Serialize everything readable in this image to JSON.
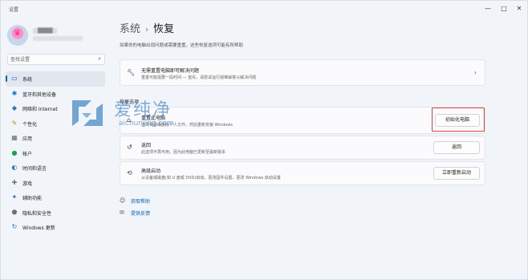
{
  "window": {
    "app_title": "设置",
    "min_glyph": "—",
    "max_glyph": "□",
    "close_glyph": "✕"
  },
  "profile": {
    "avatar_glyph": "♛",
    "username": "████",
    "email": ""
  },
  "search": {
    "placeholder": "查找设置",
    "value": ""
  },
  "sidebar": {
    "items": [
      {
        "label": "系统",
        "icon": "monitor-icon",
        "glyph": "▭",
        "color": "#0067c0",
        "active": true
      },
      {
        "label": "蓝牙和其他设备",
        "icon": "bluetooth-icon",
        "glyph": "✱",
        "color": "#0a78d4",
        "active": false
      },
      {
        "label": "网络和 Internet",
        "icon": "wifi-icon",
        "glyph": "◆",
        "color": "#2b6fc9",
        "active": false
      },
      {
        "label": "个性化",
        "icon": "brush-icon",
        "glyph": "✎",
        "color": "#d9761b",
        "active": false
      },
      {
        "label": "应用",
        "icon": "apps-icon",
        "glyph": "▦",
        "color": "#5a6b7f",
        "active": false
      },
      {
        "label": "帐户",
        "icon": "person-icon",
        "glyph": "●",
        "color": "#1f9d55",
        "active": false
      },
      {
        "label": "时间和语言",
        "icon": "globe-clock-icon",
        "glyph": "◐",
        "color": "#1a79c4",
        "active": false
      },
      {
        "label": "游戏",
        "icon": "gamepad-icon",
        "glyph": "✚",
        "color": "#6b7684",
        "active": false
      },
      {
        "label": "辅助功能",
        "icon": "accessibility-icon",
        "glyph": "✦",
        "color": "#1d6fbf",
        "active": false
      },
      {
        "label": "隐私和安全性",
        "icon": "shield-icon",
        "glyph": "⬟",
        "color": "#66707c",
        "active": false
      },
      {
        "label": "Windows 更新",
        "icon": "update-icon",
        "glyph": "↻",
        "color": "#1a79c4",
        "active": false
      }
    ]
  },
  "header": {
    "crumb_parent": "系统",
    "separator": "›",
    "crumb_current": "恢复",
    "description": "如果你的电脑出现问题或需要重置，这些恢复选项可能有所帮助"
  },
  "fix_card": {
    "title": "无需重置电脑即可解决问题",
    "subtitle": "重置可能需要一段时间 — 首先，请尝试运行疑难解答以解决问题",
    "icon": "wrench-icon",
    "chevron": "›"
  },
  "recovery_options": {
    "section_label": "恢复选项",
    "items": [
      {
        "title": "重置此电脑",
        "subtitle": "选择保留或删除个人文件，然后重新安装 Windows",
        "icon": "reset-pc-icon",
        "glyph": "⌂",
        "button": "初始化电脑"
      },
      {
        "title": "返回",
        "subtitle": "此选项不再可用，因为此电脑已更新至最新版本",
        "icon": "history-icon",
        "glyph": "↺",
        "button": "返回"
      },
      {
        "title": "高级启动",
        "subtitle": "从设备或磁盘(如 U 盘或 DVD)启动，更改固件设置，更改 Windows 启动设置",
        "icon": "advanced-startup-icon",
        "glyph": "⟲",
        "button": "立即重新启动"
      }
    ]
  },
  "help_links": {
    "items": [
      {
        "label": "获取帮助",
        "icon": "help-icon",
        "glyph": "☺"
      },
      {
        "label": "提供反馈",
        "icon": "feedback-icon",
        "glyph": "✉"
      }
    ]
  },
  "watermark": {
    "cn": "爱纯净",
    "url": "aichunjing.com"
  },
  "colors": {
    "accent": "#0067c0",
    "highlight_box": "#e0443b",
    "watermark": "#1f6fb8"
  }
}
